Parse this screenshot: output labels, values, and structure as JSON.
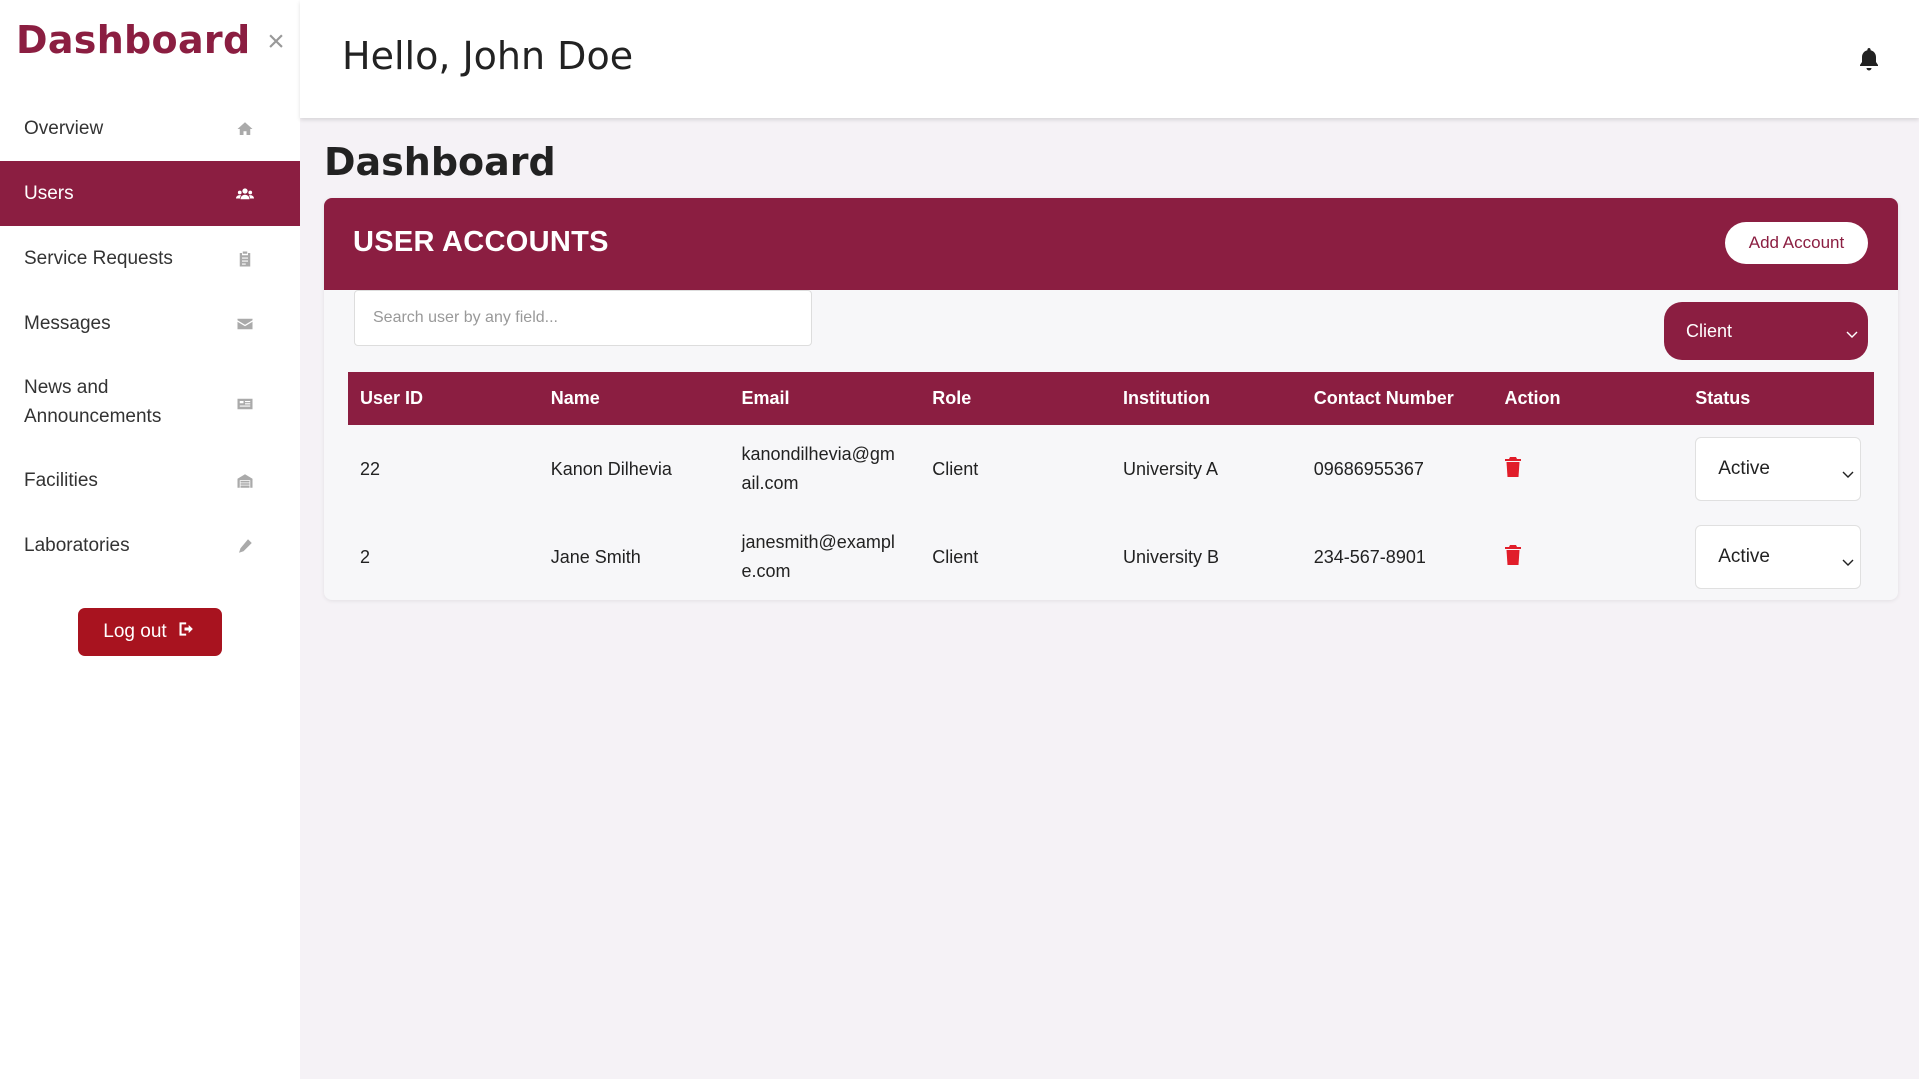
{
  "sidebar": {
    "brand": "Dashboard",
    "close_icon": "close-icon",
    "items": [
      {
        "label": "Overview",
        "icon": "home-icon"
      },
      {
        "label": "Users",
        "icon": "users-icon",
        "active": true
      },
      {
        "label": "Service Requests",
        "icon": "clipboard-icon"
      },
      {
        "label": "Messages",
        "icon": "envelope-icon"
      },
      {
        "label": "News and Announcements",
        "icon": "newspaper-icon"
      },
      {
        "label": "Facilities",
        "icon": "warehouse-icon"
      },
      {
        "label": "Laboratories",
        "icon": "pen-icon"
      }
    ],
    "logout_label": "Log out",
    "logout_icon": "sign-out-icon"
  },
  "header": {
    "greeting": "Hello, John Doe",
    "bell_icon": "bell-icon"
  },
  "main": {
    "page_title": "Dashboard",
    "card": {
      "title": "USER ACCOUNTS",
      "add_label": "Add Account",
      "search_placeholder": "Search user by any field...",
      "role_filter": "Client",
      "columns": [
        "User ID",
        "Name",
        "Email",
        "Role",
        "Institution",
        "Contact Number",
        "Action",
        "Status"
      ],
      "rows": [
        {
          "id": "22",
          "name": "Kanon Dilhevia",
          "email_line1": "kanondilhevia@gm",
          "email_line2": "ail.com",
          "role": "Client",
          "institution": "University A",
          "contact": "09686955367",
          "status": "Active"
        },
        {
          "id": "2",
          "name": "Jane Smith",
          "email_line1": "janesmith@exampl",
          "email_line2": "e.com",
          "role": "Client",
          "institution": "University B",
          "contact": "234-567-8901",
          "status": "Active"
        }
      ]
    }
  },
  "colors": {
    "brand": "#8b1e41",
    "logout": "#a8131f",
    "trash": "#e11d2a",
    "background": "#f5f2f6"
  }
}
